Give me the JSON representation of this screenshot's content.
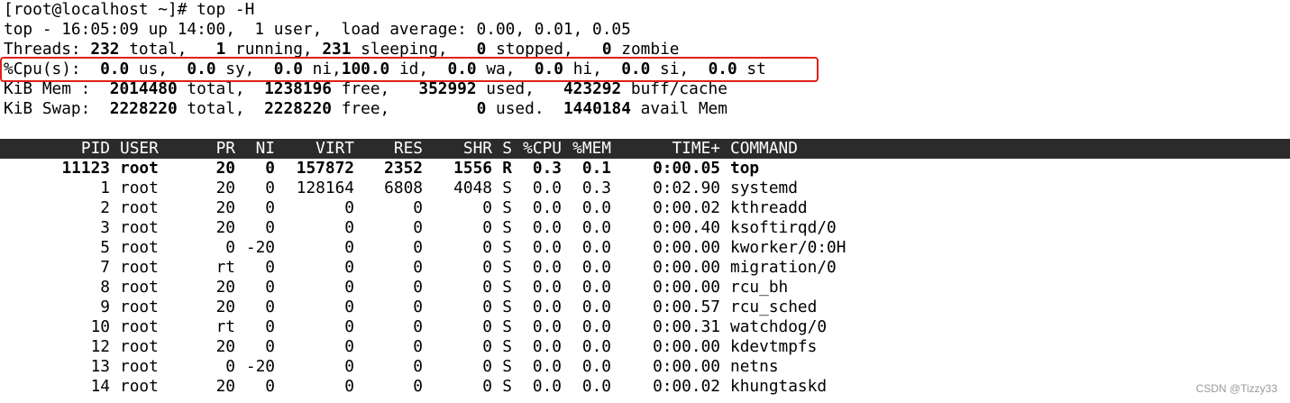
{
  "prompt": "[root@localhost ~]# top -H",
  "summary": {
    "top_line": "top - 16:05:09 up 14:00,  1 user,  load average: 0.00, 0.01, 0.05",
    "threads": {
      "label": "Threads:",
      "total": "232",
      "total_label": " total,   ",
      "running": "1",
      "running_label": " running, ",
      "sleeping": "231",
      "sleeping_label": " sleeping,   ",
      "stopped": "0",
      "stopped_label": " stopped,   ",
      "zombie": "0",
      "zombie_label": " zombie"
    },
    "cpu": {
      "label": "%Cpu(s):  ",
      "us": "0.0",
      "us_label": " us,  ",
      "sy": "0.0",
      "sy_label": " sy,  ",
      "ni": "0.0",
      "ni_label": " ni,",
      "id": "100.0",
      "id_label": " id,  ",
      "wa": "0.0",
      "wa_label": " wa,  ",
      "hi": "0.0",
      "hi_label": " hi,  ",
      "si": "0.0",
      "si_label": " si,  ",
      "st": "0.0",
      "st_label": " st"
    },
    "mem": {
      "label": "KiB Mem :  ",
      "total": "2014480",
      "total_label": " total,  ",
      "free": "1238196",
      "free_label": " free,   ",
      "used": "352992",
      "used_label": " used,   ",
      "cache": "423292",
      "cache_label": " buff/cache"
    },
    "swap": {
      "label": "KiB Swap:  ",
      "total": "2228220",
      "total_label": " total,  ",
      "free": "2228220",
      "free_label": " free,         ",
      "used": "0",
      "used_label": " used.  ",
      "avail": "1440184",
      "avail_label": " avail Mem"
    }
  },
  "table": {
    "headers": {
      "pid": "PID",
      "user": "USER",
      "pr": "PR",
      "ni": "NI",
      "virt": "VIRT",
      "res": "RES",
      "shr": "SHR",
      "s": "S",
      "cpu": "%CPU",
      "mem": "%MEM",
      "time": "TIME+",
      "command": "COMMAND"
    },
    "rows": [
      {
        "pid": "11123",
        "user": "root",
        "pr": "20",
        "ni": "0",
        "virt": "157872",
        "res": "2352",
        "shr": "1556",
        "s": "R",
        "cpu": "0.3",
        "mem": "0.1",
        "time": "0:00.05",
        "command": "top"
      },
      {
        "pid": "1",
        "user": "root",
        "pr": "20",
        "ni": "0",
        "virt": "128164",
        "res": "6808",
        "shr": "4048",
        "s": "S",
        "cpu": "0.0",
        "mem": "0.3",
        "time": "0:02.90",
        "command": "systemd"
      },
      {
        "pid": "2",
        "user": "root",
        "pr": "20",
        "ni": "0",
        "virt": "0",
        "res": "0",
        "shr": "0",
        "s": "S",
        "cpu": "0.0",
        "mem": "0.0",
        "time": "0:00.02",
        "command": "kthreadd"
      },
      {
        "pid": "3",
        "user": "root",
        "pr": "20",
        "ni": "0",
        "virt": "0",
        "res": "0",
        "shr": "0",
        "s": "S",
        "cpu": "0.0",
        "mem": "0.0",
        "time": "0:00.40",
        "command": "ksoftirqd/0"
      },
      {
        "pid": "5",
        "user": "root",
        "pr": "0",
        "ni": "-20",
        "virt": "0",
        "res": "0",
        "shr": "0",
        "s": "S",
        "cpu": "0.0",
        "mem": "0.0",
        "time": "0:00.00",
        "command": "kworker/0:0H"
      },
      {
        "pid": "7",
        "user": "root",
        "pr": "rt",
        "ni": "0",
        "virt": "0",
        "res": "0",
        "shr": "0",
        "s": "S",
        "cpu": "0.0",
        "mem": "0.0",
        "time": "0:00.00",
        "command": "migration/0"
      },
      {
        "pid": "8",
        "user": "root",
        "pr": "20",
        "ni": "0",
        "virt": "0",
        "res": "0",
        "shr": "0",
        "s": "S",
        "cpu": "0.0",
        "mem": "0.0",
        "time": "0:00.00",
        "command": "rcu_bh"
      },
      {
        "pid": "9",
        "user": "root",
        "pr": "20",
        "ni": "0",
        "virt": "0",
        "res": "0",
        "shr": "0",
        "s": "S",
        "cpu": "0.0",
        "mem": "0.0",
        "time": "0:00.57",
        "command": "rcu_sched"
      },
      {
        "pid": "10",
        "user": "root",
        "pr": "rt",
        "ni": "0",
        "virt": "0",
        "res": "0",
        "shr": "0",
        "s": "S",
        "cpu": "0.0",
        "mem": "0.0",
        "time": "0:00.31",
        "command": "watchdog/0"
      },
      {
        "pid": "12",
        "user": "root",
        "pr": "20",
        "ni": "0",
        "virt": "0",
        "res": "0",
        "shr": "0",
        "s": "S",
        "cpu": "0.0",
        "mem": "0.0",
        "time": "0:00.00",
        "command": "kdevtmpfs"
      },
      {
        "pid": "13",
        "user": "root",
        "pr": "0",
        "ni": "-20",
        "virt": "0",
        "res": "0",
        "shr": "0",
        "s": "S",
        "cpu": "0.0",
        "mem": "0.0",
        "time": "0:00.00",
        "command": "netns"
      },
      {
        "pid": "14",
        "user": "root",
        "pr": "20",
        "ni": "0",
        "virt": "0",
        "res": "0",
        "shr": "0",
        "s": "S",
        "cpu": "0.0",
        "mem": "0.0",
        "time": "0:00.02",
        "command": "khungtaskd"
      }
    ]
  },
  "annotation": {
    "highlight_color": "#e0201b"
  },
  "watermark": "CSDN @Tizzy33",
  "colors": {
    "header_bg": "#2b2b2b",
    "header_fg": "#ffffff",
    "text": "#000000",
    "background": "#ffffff"
  }
}
